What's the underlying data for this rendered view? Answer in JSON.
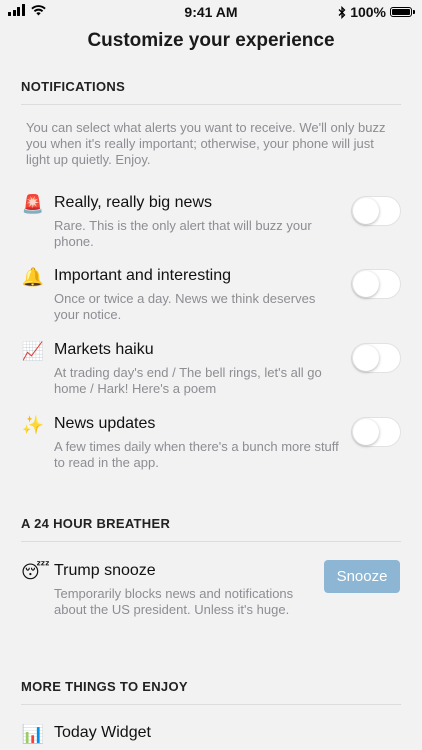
{
  "status_bar": {
    "time": "9:41 AM",
    "battery": "100%"
  },
  "page_title": "Customize your experience",
  "notifications": {
    "header": "NOTIFICATIONS",
    "intro": "You can select what alerts you want to receive. We'll only buzz you when it's really important; otherwise, your phone will just light up quietly. Enjoy.",
    "items": [
      {
        "emoji": "🚨",
        "title": "Really, really big news",
        "desc": "Rare. This is the only alert that will buzz your phone.",
        "enabled": false
      },
      {
        "emoji": "🔔",
        "title": "Important and interesting",
        "desc": "Once or twice a day. News we think deserves your notice.",
        "enabled": false
      },
      {
        "emoji": "📈",
        "title": "Markets haiku",
        "desc": "At trading day's end / The bell rings, let's all go home / Hark! Here's a poem",
        "enabled": false
      },
      {
        "emoji": "✨",
        "title": "News updates",
        "desc": "A few times daily when there's a bunch more stuff to read in the app.",
        "enabled": false
      }
    ]
  },
  "breather": {
    "header": "A 24 HOUR BREATHER",
    "item": {
      "emoji": "😴",
      "title": "Trump snooze",
      "desc": "Temporarily blocks news and notifications about the US president. Unless it's huge.",
      "button": "Snooze"
    }
  },
  "more": {
    "header": "MORE THINGS TO ENJOY",
    "item": {
      "emoji": "📊",
      "title": "Today Widget"
    }
  },
  "colors": {
    "background": "#f2f2f3",
    "button": "#8db6d4",
    "muted_text": "#8d8d92",
    "divider": "#dcdcde"
  }
}
